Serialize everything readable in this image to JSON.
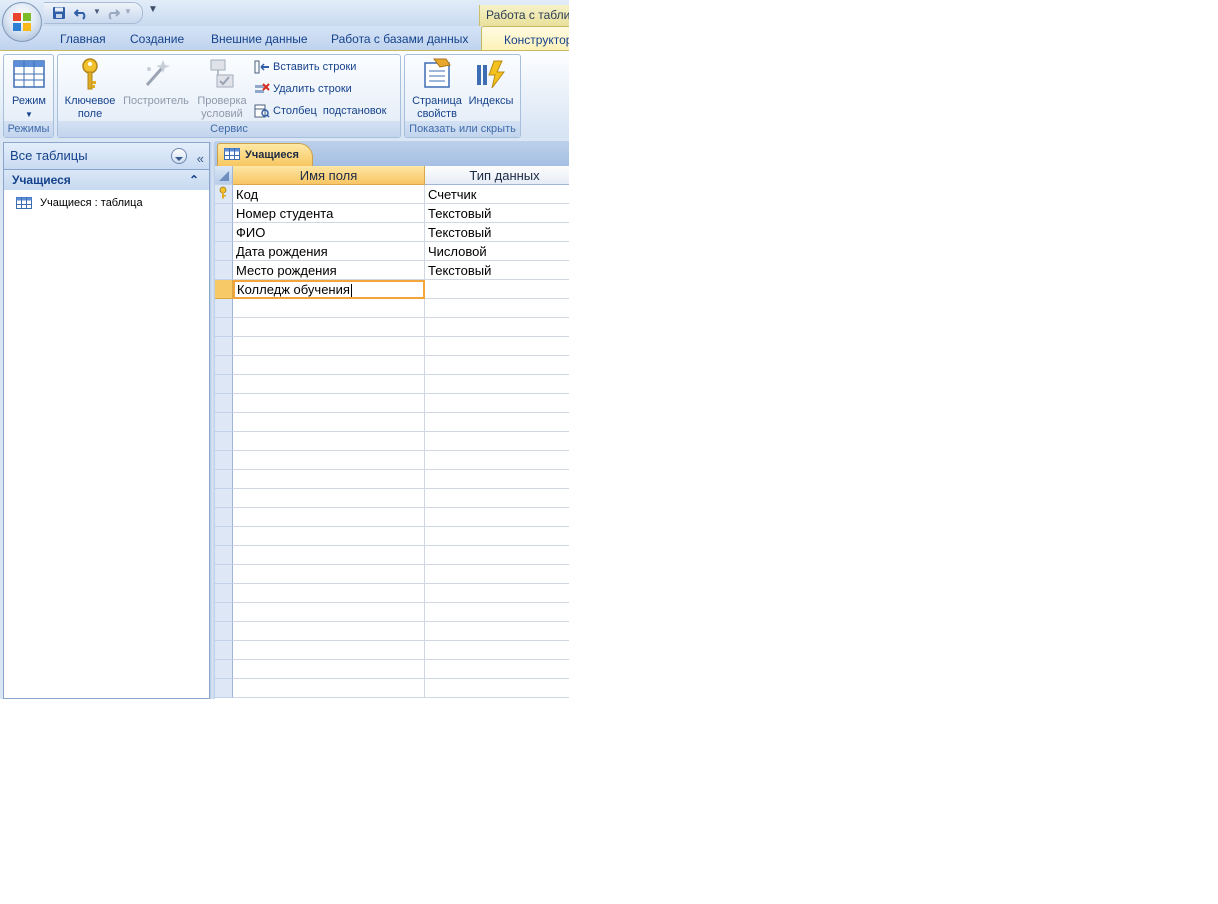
{
  "ribbon": {
    "context_tab_header": "Работа с таблицами",
    "tabs": [
      {
        "label": "Главная"
      },
      {
        "label": "Создание"
      },
      {
        "label": "Внешние данные"
      },
      {
        "label": "Работа с базами данных"
      },
      {
        "label": "Конструктор"
      }
    ],
    "groups": {
      "modes": {
        "label": "Режимы",
        "view_button": "Режим"
      },
      "tools": {
        "label": "Сервис",
        "primary_key_line1": "Ключевое",
        "primary_key_line2": "поле",
        "builder": "Построитель",
        "test_rules_line1": "Проверка",
        "test_rules_line2": "условий",
        "insert_rows": "Вставить строки",
        "delete_rows": "Удалить строки",
        "lookup_column": "Столбец  подстановок"
      },
      "show_hide": {
        "label": "Показать или скрыть",
        "property_sheet_line1": "Страница",
        "property_sheet_line2": "свойств",
        "indexes": "Индексы"
      }
    }
  },
  "nav_pane": {
    "header": "Все таблицы",
    "group": "Учащиеся",
    "items": [
      {
        "label": "Учащиеся : таблица"
      }
    ]
  },
  "document": {
    "tab_title": "Учащиеся",
    "columns": [
      "Имя поля",
      "Тип данных"
    ],
    "rows": [
      {
        "field": "Код",
        "type": "Счетчик",
        "primary_key": true
      },
      {
        "field": "Номер студента",
        "type": "Текстовый"
      },
      {
        "field": "ФИО",
        "type": "Текстовый"
      },
      {
        "field": "Дата рождения",
        "type": "Числовой"
      },
      {
        "field": "Место рождения",
        "type": "Текстовый"
      },
      {
        "field": "Колледж обучения",
        "type": "",
        "editing": true
      }
    ],
    "empty_rows": 21
  },
  "colors": {
    "ribbon_text": "#15428b",
    "active_orange": "#f8c564",
    "edit_border": "#f3a43a"
  }
}
